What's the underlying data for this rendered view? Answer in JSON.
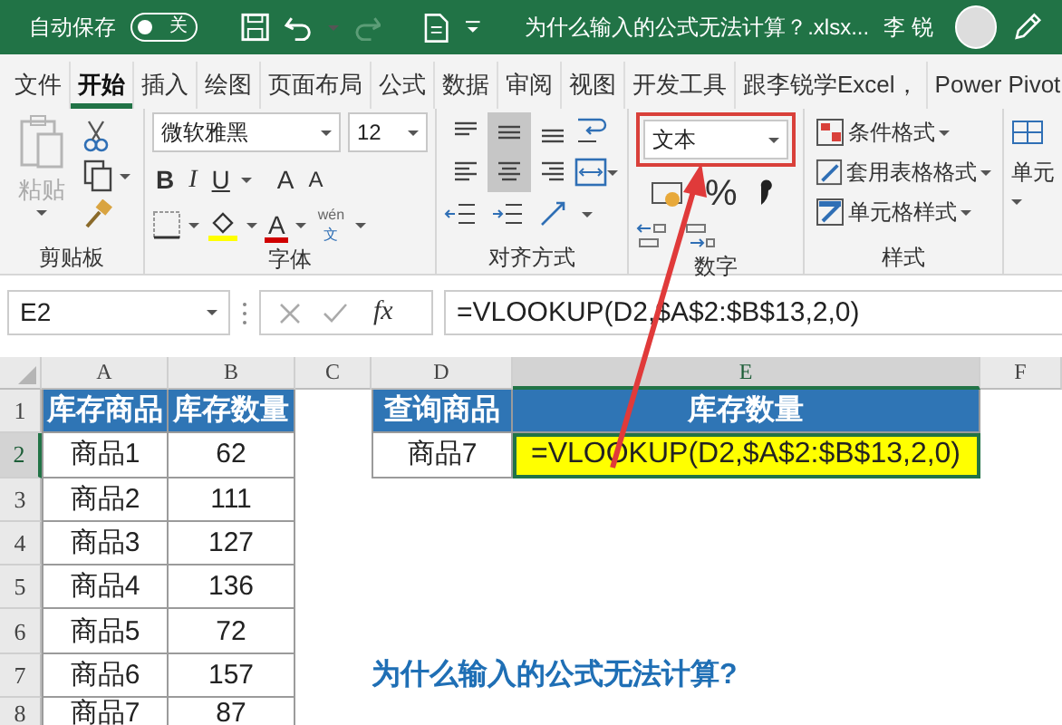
{
  "title_bar": {
    "autosave_label": "自动保存",
    "autosave": {
      "on": false,
      "label": "关"
    },
    "document_title": "为什么输入的公式无法计算？.xlsx...",
    "user": "李 锐"
  },
  "ribbon_tabs": [
    {
      "label": "文件",
      "selected": false
    },
    {
      "label": "开始",
      "selected": true
    },
    {
      "label": "插入",
      "selected": false
    },
    {
      "label": "绘图",
      "selected": false
    },
    {
      "label": "页面布局",
      "selected": false
    },
    {
      "label": "公式",
      "selected": false
    },
    {
      "label": "数据",
      "selected": false
    },
    {
      "label": "审阅",
      "selected": false
    },
    {
      "label": "视图",
      "selected": false
    },
    {
      "label": "开发工具",
      "selected": false
    },
    {
      "label": "跟李锐学Excel，",
      "selected": false
    },
    {
      "label": "Power Pivot",
      "selected": false
    }
  ],
  "ribbon": {
    "clipboard": {
      "paste": "粘贴",
      "group": "剪贴板"
    },
    "font": {
      "font_name": "微软雅黑",
      "font_size": "12",
      "bold": "B",
      "italic": "I",
      "underline": "U",
      "grow": "A",
      "shrink": "A",
      "font_color": "A",
      "phonetic": "wén",
      "phonetic_char": "文",
      "group": "字体"
    },
    "alignment": {
      "buttons": [
        {
          "kind": "top",
          "selected": false
        },
        {
          "kind": "middle",
          "selected": true
        },
        {
          "kind": "bottom",
          "selected": false
        },
        {
          "kind": "left",
          "selected": false
        },
        {
          "kind": "center",
          "selected": true
        },
        {
          "kind": "right",
          "selected": false
        }
      ],
      "group": "对齐方式"
    },
    "number": {
      "format": "文本",
      "highlighted": true,
      "percent": "%",
      "group": "数字"
    },
    "styles": {
      "items": [
        "条件格式",
        "套用表格格式",
        "单元格样式"
      ],
      "group": "样式"
    },
    "cells": {
      "label": "单元"
    }
  },
  "formula_bar": {
    "name_box": "E2",
    "function_label": "fx",
    "formula": "=VLOOKUP(D2,$A$2:$B$13,2,0)"
  },
  "sheet": {
    "columns": [
      {
        "label": "A",
        "selected": false
      },
      {
        "label": "B",
        "selected": false
      },
      {
        "label": "C",
        "selected": false
      },
      {
        "label": "D",
        "selected": false
      },
      {
        "label": "E",
        "selected": true
      },
      {
        "label": "F",
        "selected": false
      }
    ],
    "rows": [
      {
        "label": "1",
        "selected": false
      },
      {
        "label": "2",
        "selected": true
      },
      {
        "label": "3",
        "selected": false
      },
      {
        "label": "4",
        "selected": false
      },
      {
        "label": "5",
        "selected": false
      },
      {
        "label": "6",
        "selected": false
      },
      {
        "label": "7",
        "selected": false
      },
      {
        "label": "8",
        "selected": false
      }
    ],
    "inventory": {
      "headers": [
        "库存商品",
        "库存数量"
      ],
      "rows": [
        [
          "商品1",
          "62"
        ],
        [
          "商品2",
          "111"
        ],
        [
          "商品3",
          "127"
        ],
        [
          "商品4",
          "136"
        ],
        [
          "商品5",
          "72"
        ],
        [
          "商品6",
          "157"
        ],
        [
          "商品7",
          "87"
        ]
      ]
    },
    "lookup": {
      "headers": [
        "查询商品",
        "库存数量"
      ],
      "query": "商品7",
      "result": "=VLOOKUP(D2,$A$2:$B$13,2,0)",
      "result_selected": true
    },
    "note": "为什么输入的公式无法计算?"
  }
}
